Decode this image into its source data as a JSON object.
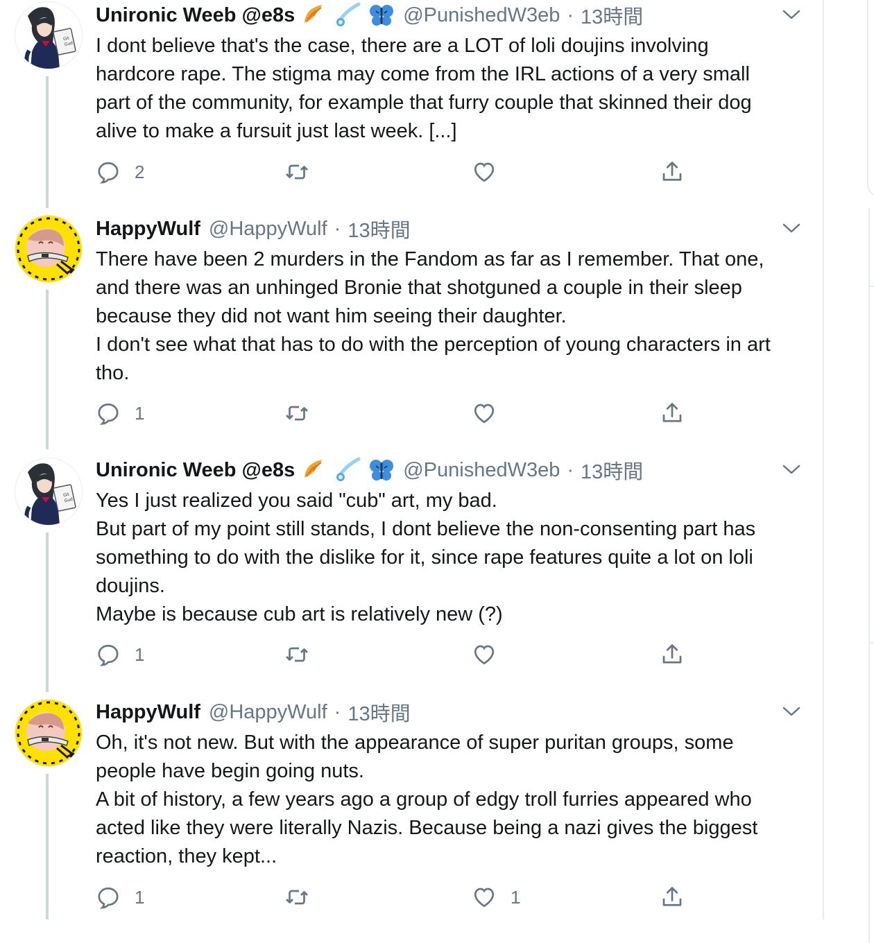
{
  "tweets": [
    {
      "name": "Unironic Weeb @e8s",
      "emojis": [
        "croissant-emoji",
        "comet-emoji",
        "butterfly-emoji"
      ],
      "handle": "@PunishedW3eb",
      "dot": "·",
      "time": "13時間",
      "text": "I dont believe that's the case, there are a LOT of loli doujins involving\nhardcore rape. The stigma may come from the IRL actions of a very small\npart of the community, for example that furry couple that skinned their dog\nalive to make a fursuit just last week. [...]",
      "reply_count": "2",
      "retweet_count": "",
      "like_count": "",
      "avatar_text": "Git\nGud"
    },
    {
      "name": "HappyWulf",
      "emojis": [],
      "handle": "@HappyWulf",
      "dot": "·",
      "time": "13時間",
      "text": "There have been 2 murders in the Fandom as far as I remember. That one,\nand there was an unhinged Bronie that shotguned a couple in their sleep\nbecause they did not want him seeing their daughter.\nI don't see what that has to do with the perception of young characters in art\ntho.",
      "reply_count": "1",
      "retweet_count": "",
      "like_count": ""
    },
    {
      "name": "Unironic Weeb @e8s",
      "emojis": [
        "croissant-emoji",
        "comet-emoji",
        "butterfly-emoji"
      ],
      "handle": "@PunishedW3eb",
      "dot": "·",
      "time": "13時間",
      "text": "Yes I just realized you said \"cub\" art, my bad.\nBut part of my point still stands, I dont believe the non-consenting part has\nsomething to do with the dislike for it, since rape features quite a lot on loli\ndoujins.\nMaybe is because cub art is relatively new (?)",
      "reply_count": "1",
      "retweet_count": "",
      "like_count": "",
      "avatar_text": "Git\nGud"
    },
    {
      "name": "HappyWulf",
      "emojis": [],
      "handle": "@HappyWulf",
      "dot": "·",
      "time": "13時間",
      "text": "Oh, it's not new. But with the appearance of super puritan groups, some\npeople have begin going nuts.\nA bit of history, a few years ago a group of edgy troll furries appeared who\nacted like they were literally Nazis. Because being a nazi gives the biggest\nreaction, they kept...",
      "reply_count": "1",
      "retweet_count": "",
      "like_count": "1"
    }
  ],
  "icons": {
    "reply": "reply-icon",
    "retweet": "retweet-icon",
    "like": "heart-icon",
    "share": "share-icon",
    "more": "chevron-down-icon"
  },
  "colors": {
    "text": "#14171a",
    "secondary": "#657786",
    "thread_line": "#ccd6dd",
    "avatar_yellow": "#ffe100"
  }
}
